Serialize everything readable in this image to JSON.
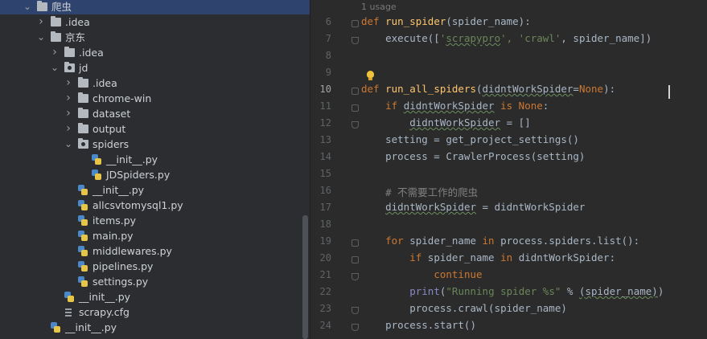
{
  "tree": {
    "items": [
      {
        "label": "爬虫",
        "kind": "folder",
        "expanded": true
      },
      {
        "label": ".idea",
        "kind": "folder",
        "expanded": false
      },
      {
        "label": "京东",
        "kind": "folder",
        "expanded": true
      },
      {
        "label": ".idea",
        "kind": "folder",
        "expanded": false
      },
      {
        "label": "jd",
        "kind": "package",
        "expanded": true
      },
      {
        "label": ".idea",
        "kind": "folder",
        "expanded": false
      },
      {
        "label": "chrome-win",
        "kind": "folder",
        "expanded": false
      },
      {
        "label": "dataset",
        "kind": "folder",
        "expanded": false
      },
      {
        "label": "output",
        "kind": "folder",
        "expanded": false
      },
      {
        "label": "spiders",
        "kind": "package",
        "expanded": true
      },
      {
        "label": "__init__.py",
        "kind": "python"
      },
      {
        "label": "JDSpiders.py",
        "kind": "python"
      },
      {
        "label": "__init__.py",
        "kind": "python"
      },
      {
        "label": "allcsvtomysql1.py",
        "kind": "python"
      },
      {
        "label": "items.py",
        "kind": "python"
      },
      {
        "label": "main.py",
        "kind": "python"
      },
      {
        "label": "middlewares.py",
        "kind": "python"
      },
      {
        "label": "pipelines.py",
        "kind": "python"
      },
      {
        "label": "settings.py",
        "kind": "python"
      },
      {
        "label": "__init__.py",
        "kind": "python"
      },
      {
        "label": "scrapy.cfg",
        "kind": "config"
      },
      {
        "label": "__init__.py",
        "kind": "python"
      }
    ]
  },
  "editor": {
    "usage_hint": "1 usage",
    "current_line": "10",
    "lines": [
      {
        "n": "6",
        "tokens": [
          {
            "t": "def ",
            "c": "kw"
          },
          {
            "t": "run_spider",
            "c": "fn"
          },
          {
            "t": "(spider_name):"
          }
        ]
      },
      {
        "n": "7",
        "tokens": [
          {
            "t": "    execute(["
          },
          {
            "t": "'",
            "c": "str"
          },
          {
            "t": "scrapypro",
            "c": "str ul"
          },
          {
            "t": "', 'crawl'",
            "c": "str"
          },
          {
            "t": ", spider_name])"
          }
        ]
      },
      {
        "n": "8",
        "tokens": []
      },
      {
        "n": "9",
        "tokens": []
      },
      {
        "n": "10",
        "tokens": [
          {
            "t": "def ",
            "c": "kw"
          },
          {
            "t": "run_all_spiders",
            "c": "fn"
          },
          {
            "t": "("
          },
          {
            "t": "didntWorkSpider",
            "c": "ul"
          },
          {
            "t": "="
          },
          {
            "t": "None",
            "c": "kw"
          },
          {
            "t": "):"
          }
        ]
      },
      {
        "n": "11",
        "tokens": [
          {
            "t": "    "
          },
          {
            "t": "if ",
            "c": "kw"
          },
          {
            "t": "didntWorkSpider",
            "c": "ul"
          },
          {
            "t": " "
          },
          {
            "t": "is None",
            "c": "kw"
          },
          {
            "t": ":"
          }
        ]
      },
      {
        "n": "12",
        "tokens": [
          {
            "t": "        "
          },
          {
            "t": "didntWorkSpider",
            "c": "ul"
          },
          {
            "t": " = []"
          }
        ]
      },
      {
        "n": "13",
        "tokens": [
          {
            "t": "    setting = get_project_settings()"
          }
        ]
      },
      {
        "n": "14",
        "tokens": [
          {
            "t": "    process = CrawlerProcess(setting)"
          }
        ]
      },
      {
        "n": "15",
        "tokens": []
      },
      {
        "n": "16",
        "tokens": [
          {
            "t": "    # 不需要工作的爬虫",
            "c": "cm"
          }
        ]
      },
      {
        "n": "17",
        "tokens": [
          {
            "t": "    "
          },
          {
            "t": "didntWorkSpider",
            "c": "ul"
          },
          {
            "t": " = didntWorkSpider"
          }
        ]
      },
      {
        "n": "18",
        "tokens": []
      },
      {
        "n": "19",
        "tokens": [
          {
            "t": "    "
          },
          {
            "t": "for ",
            "c": "kw"
          },
          {
            "t": "spider_name "
          },
          {
            "t": "in ",
            "c": "kw"
          },
          {
            "t": "process.spiders.list():"
          }
        ]
      },
      {
        "n": "20",
        "tokens": [
          {
            "t": "        "
          },
          {
            "t": "if ",
            "c": "kw"
          },
          {
            "t": "spider_name "
          },
          {
            "t": "in ",
            "c": "kw"
          },
          {
            "t": "didntWorkSpider:"
          }
        ]
      },
      {
        "n": "21",
        "tokens": [
          {
            "t": "            "
          },
          {
            "t": "continue",
            "c": "kw"
          }
        ]
      },
      {
        "n": "22",
        "tokens": [
          {
            "t": "        "
          },
          {
            "t": "print",
            "c": "bi"
          },
          {
            "t": "("
          },
          {
            "t": "\"Running spider %s\"",
            "c": "str"
          },
          {
            "t": " % "
          },
          {
            "t": "(spider_name)",
            "c": "ul"
          },
          {
            "t": ")"
          }
        ]
      },
      {
        "n": "23",
        "tokens": [
          {
            "t": "        process.crawl(spider_name)"
          }
        ]
      },
      {
        "n": "24",
        "tokens": [
          {
            "t": "    process.start()"
          }
        ]
      }
    ]
  }
}
